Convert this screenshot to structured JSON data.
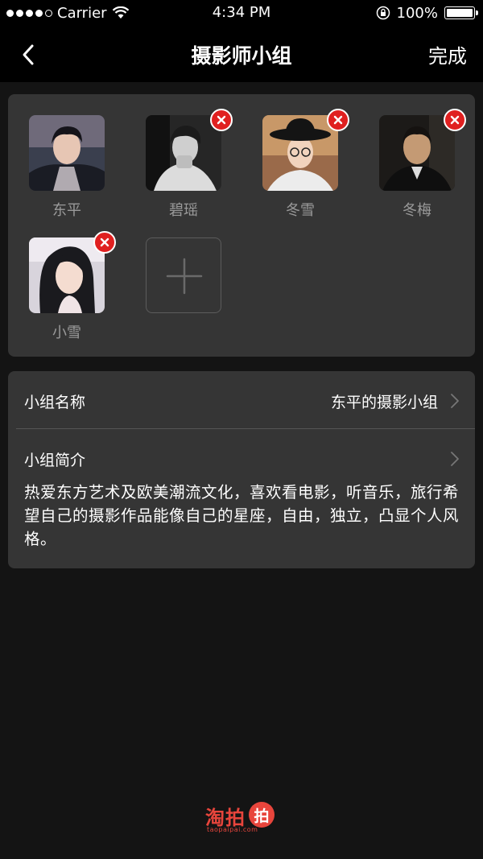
{
  "status_bar": {
    "carrier": "Carrier",
    "time": "4:34 PM",
    "battery": "100%",
    "battery_level": 1.0,
    "signal_icon": "signal-dots-icon",
    "wifi_icon": "wifi-icon",
    "rotation_lock_icon": "rotation-lock-icon"
  },
  "nav": {
    "title": "摄影师小组",
    "done_label": "完成",
    "back_icon": "chevron-left-icon"
  },
  "members": [
    {
      "name": "东平",
      "removable": false
    },
    {
      "name": "碧瑶",
      "removable": true
    },
    {
      "name": "冬雪",
      "removable": true
    },
    {
      "name": "冬梅",
      "removable": true
    },
    {
      "name": "小雪",
      "removable": true
    }
  ],
  "add_member_icon": "plus-icon",
  "group_info": {
    "name_label": "小组名称",
    "name_value": "东平的摄影小组",
    "intro_label": "小组简介",
    "intro_text": "热爱东方艺术及欧美潮流文化，喜欢看电影，听音乐，旅行希望自己的摄影作品能像自己的星座，自由，独立，凸显个人风格。"
  },
  "logo": {
    "text": "淘拍",
    "bubble": "拍",
    "sub": "taopaipai.com"
  },
  "colors": {
    "background": "#141414",
    "card": "#353535",
    "remove_badge": "#e02020",
    "brand": "#e8453c"
  }
}
